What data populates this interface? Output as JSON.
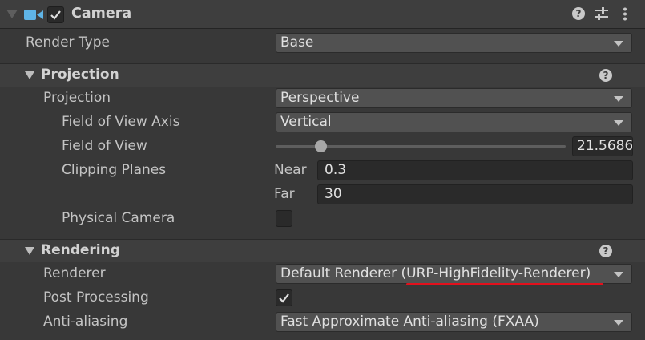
{
  "component": {
    "title": "Camera",
    "enabled": true,
    "icons": [
      "camera-icon",
      "help-icon",
      "presets-icon",
      "kebab-menu-icon"
    ]
  },
  "render_type": {
    "label": "Render Type",
    "value": "Base"
  },
  "projection_section": {
    "title": "Projection",
    "projection": {
      "label": "Projection",
      "value": "Perspective"
    },
    "fov_axis": {
      "label": "Field of View Axis",
      "value": "Vertical"
    },
    "fov": {
      "label": "Field of View",
      "value": "21.5686",
      "slider_fraction": 0.14
    },
    "clipping": {
      "label": "Clipping Planes",
      "near_label": "Near",
      "near_value": "0.3",
      "far_label": "Far",
      "far_value": "30"
    },
    "physical_camera": {
      "label": "Physical Camera",
      "checked": false
    }
  },
  "rendering_section": {
    "title": "Rendering",
    "renderer": {
      "label": "Renderer",
      "value": "Default Renderer (URP-HighFidelity-Renderer)"
    },
    "post_processing": {
      "label": "Post Processing",
      "checked": true
    },
    "anti_aliasing": {
      "label": "Anti-aliasing",
      "value": "Fast Approximate Anti-aliasing (FXAA)"
    }
  },
  "colors": {
    "panel_bg": "#383838",
    "field_bg": "#515151",
    "annotation_underline": "#e3101c",
    "camera_icon": "#5fb4e6"
  }
}
